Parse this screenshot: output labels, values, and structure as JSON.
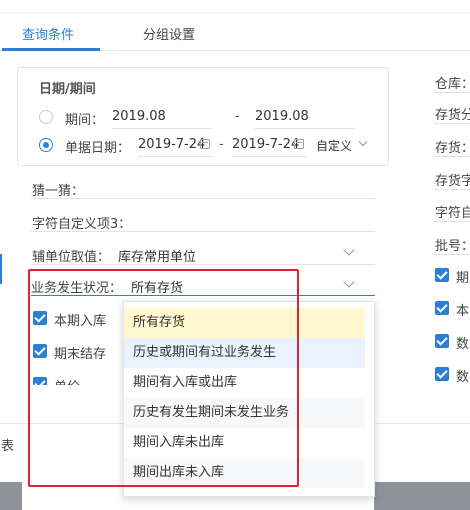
{
  "tabs": [
    {
      "label": "查询条件",
      "active": true
    },
    {
      "label": "分组设置",
      "active": false
    }
  ],
  "date_section": {
    "title": "日期/期间",
    "period": {
      "label": "期间：",
      "from": "2019.08",
      "separator": "-",
      "to": "2019.08",
      "selected": false
    },
    "doc_date": {
      "label": "单据日期：",
      "from": "2019-7-24",
      "separator": "-",
      "to": "2019-7-24",
      "range_option": "自定义",
      "selected": true
    }
  },
  "fields": {
    "guess": {
      "label": "猜一猜："
    },
    "custom_item3": {
      "label": "字符自定义项3："
    },
    "aux_unit": {
      "label": "辅单位取值：",
      "value": "库存常用单位"
    },
    "business_status": {
      "label": "业务发生状况：",
      "value": "所有存货"
    }
  },
  "checkboxes": [
    {
      "label": "本期入库",
      "checked": true
    },
    {
      "label": "期末结存",
      "checked": true
    },
    {
      "label": "单价",
      "checked": true
    }
  ],
  "dropdown": {
    "options": [
      "所有存货",
      "历史或期间有过业务发生",
      "期间有入库或出库",
      "历史有发生期间未发生业务",
      "期间入库未出库",
      "期间出库未入库"
    ],
    "selected_index": 0
  },
  "right_column": {
    "labels": [
      "仓库：",
      "存货分",
      "存货：",
      "存货字",
      "字符自",
      "批号："
    ],
    "checkboxes": [
      "期",
      "本",
      "数",
      "数"
    ]
  },
  "footer": {
    "cut_text": "报表"
  },
  "colors": {
    "accent": "#2b7fd9",
    "highlight_box": "#e0242f",
    "selected_option": "#fff7cf"
  }
}
